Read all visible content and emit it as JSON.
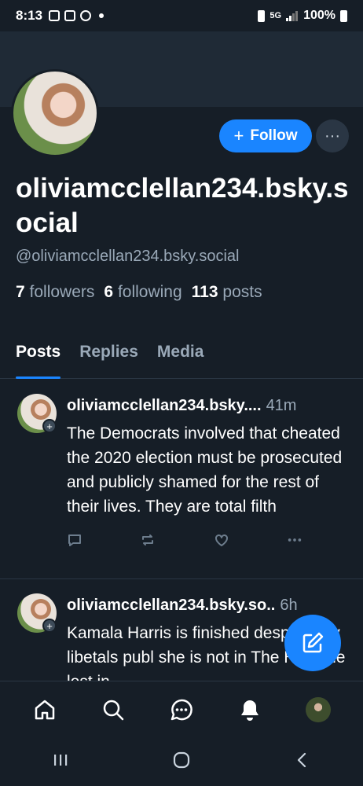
{
  "status_bar": {
    "time": "8:13",
    "network": "5G",
    "battery": "100%"
  },
  "profile": {
    "display_name": "oliviamcclellan234.bsky.social",
    "handle": "@oliviamcclellan234.bsky.social",
    "followers_count": "7",
    "followers_label": "followers",
    "following_count": "6",
    "following_label": "following",
    "posts_count": "113",
    "posts_label": "posts",
    "follow_label": "Follow",
    "more_label": "···"
  },
  "tabs": [
    {
      "label": "Posts",
      "active": true
    },
    {
      "label": "Replies",
      "active": false
    },
    {
      "label": "Media",
      "active": false
    }
  ],
  "posts": [
    {
      "author": "oliviamcclellan234.bsky....",
      "time": "41m",
      "text": "The Democrats involved that cheated the 2020 election must be prosecuted and publicly shamed for the rest of their lives. They are total filth"
    },
    {
      "author": "oliviamcclellan234.bsky.so..",
      "time": "6h",
      "text": "Kamala Harris is finished despite filtjy libetals publ         she is not in The Hill. She lost in"
    }
  ],
  "nav": [
    "home-icon",
    "search-icon",
    "chat-icon",
    "notifications-icon",
    "profile-avatar"
  ],
  "colors": {
    "accent": "#1a85ff",
    "background": "#161e27",
    "muted": "#9aa9b8"
  }
}
